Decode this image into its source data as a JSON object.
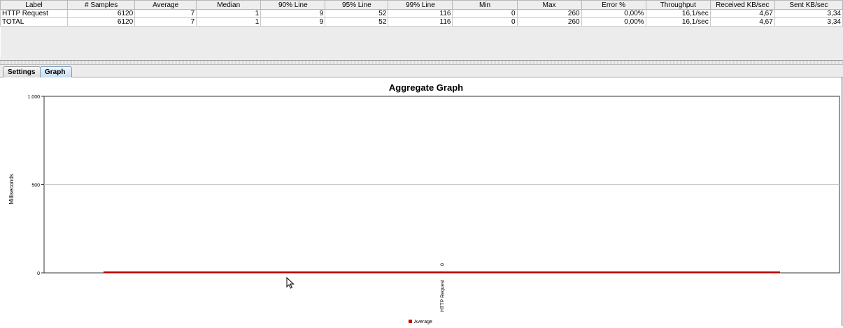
{
  "table": {
    "columns": [
      "Label",
      "# Samples",
      "Average",
      "Median",
      "90% Line",
      "95% Line",
      "99% Line",
      "Min",
      "Max",
      "Error %",
      "Throughput",
      "Received KB/sec",
      "Sent KB/sec"
    ],
    "rows": [
      [
        "HTTP Request",
        "6120",
        "7",
        "1",
        "9",
        "52",
        "116",
        "0",
        "260",
        "0,00%",
        "16,1/sec",
        "4,67",
        "3,34"
      ],
      [
        "TOTAL",
        "6120",
        "7",
        "1",
        "9",
        "52",
        "116",
        "0",
        "260",
        "0,00%",
        "16,1/sec",
        "4,67",
        "3,34"
      ]
    ]
  },
  "tabs": [
    {
      "label": "Settings",
      "active": false
    },
    {
      "label": "Graph",
      "active": true
    }
  ],
  "chart_data": {
    "type": "bar",
    "title": "Aggregate Graph",
    "ylabel": "Milliseconds",
    "xlabel": "",
    "categories": [
      "HTTP Request"
    ],
    "series": [
      {
        "name": "Average",
        "values": [
          7
        ],
        "color": "#cc0000"
      }
    ],
    "bar_value_label": "0",
    "ylim": [
      0,
      1000
    ],
    "yticks": [
      0,
      500,
      1000
    ],
    "ytick_labels": [
      "0",
      "500",
      "1.000"
    ],
    "grid": true,
    "legend_position": "bottom"
  },
  "colors": {
    "bar": "#cc0000",
    "tab_active": "#c7dcf3",
    "grid": "#c8c8c8"
  },
  "icons": {
    "cursor": "mouse-pointer-icon"
  }
}
